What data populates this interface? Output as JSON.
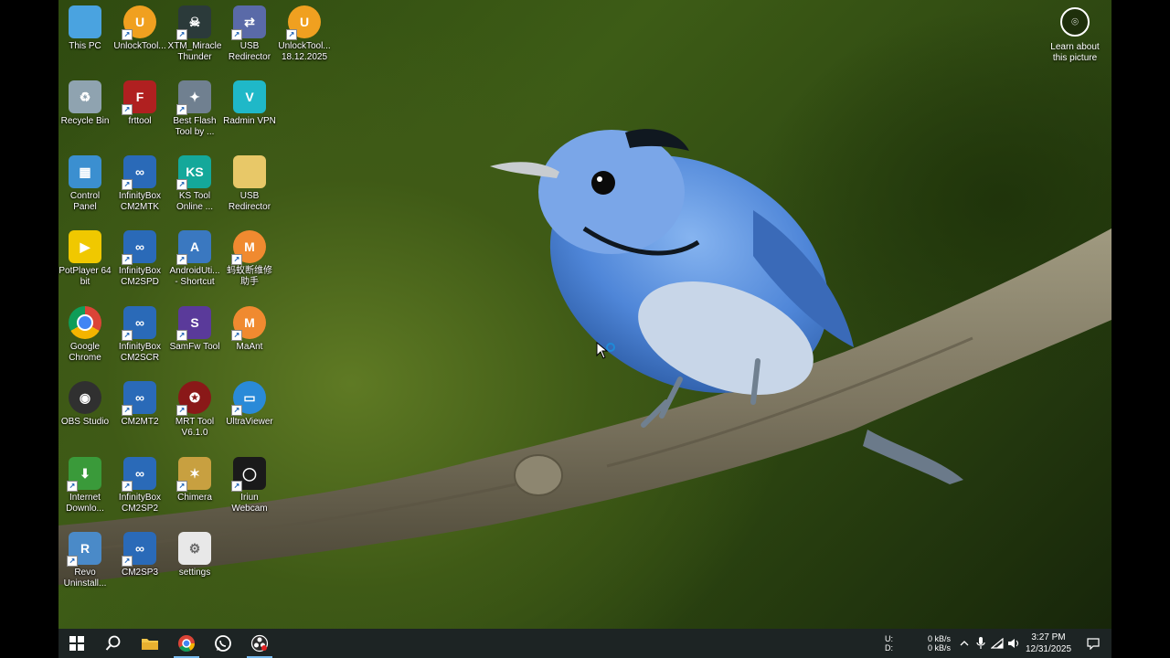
{
  "desktop_icons": [
    {
      "name": "icon-this-pc",
      "label": "This PC",
      "glyph": "computer-icon",
      "color": "#4aa3e0",
      "text": "",
      "shortcut": false
    },
    {
      "name": "icon-unlocktool-1",
      "label": "UnlockTool...",
      "glyph": "unlocktool-icon",
      "color": "#f0a020",
      "text": "U",
      "shortcut": true
    },
    {
      "name": "icon-xtm-miracle",
      "label": "XTM_Miracle\nThunder",
      "glyph": "skull-icon",
      "color": "#2b3a3a",
      "text": "☠",
      "shortcut": true
    },
    {
      "name": "icon-usb-redirector-1",
      "label": "USB\nRedirector",
      "glyph": "network-icon",
      "color": "#5a6aa8",
      "text": "⇄",
      "shortcut": true
    },
    {
      "name": "icon-unlocktool-2",
      "label": "UnlockTool...\n18.12.2025",
      "glyph": "unlocktool-icon",
      "color": "#f0a020",
      "text": "U",
      "shortcut": true
    },
    {
      "name": "icon-recycle-bin",
      "label": "Recycle Bin",
      "glyph": "recycle-bin-icon",
      "color": "#8fa3b0",
      "text": "♻",
      "shortcut": false
    },
    {
      "name": "icon-frttool",
      "label": "frttool",
      "glyph": "frttool-icon",
      "color": "#b02020",
      "text": "F",
      "shortcut": true
    },
    {
      "name": "icon-best-flash-tool",
      "label": "Best Flash\nTool by ...",
      "glyph": "tools-icon",
      "color": "#708090",
      "text": "✦",
      "shortcut": true
    },
    {
      "name": "icon-radmin-vpn",
      "label": "Radmin VPN",
      "glyph": "radmin-vpn-icon",
      "color": "#1fb8c8",
      "text": "V",
      "shortcut": false
    },
    {
      "name": "icon-control-panel",
      "label": "Control\nPanel",
      "glyph": "control-panel-icon",
      "color": "#3b8fd0",
      "text": "▦",
      "shortcut": false
    },
    {
      "name": "icon-infinitybox-cm2mtk",
      "label": "InfinityBox\nCM2MTK",
      "glyph": "infinity-icon",
      "color": "#2a6ab8",
      "text": "∞",
      "shortcut": true
    },
    {
      "name": "icon-ks-tool",
      "label": "KS Tool\nOnline ...",
      "glyph": "ks-tool-icon",
      "color": "#14a89a",
      "text": "KS",
      "shortcut": true
    },
    {
      "name": "icon-usb-redirector-2",
      "label": "USB\nRedirector",
      "glyph": "folder-icon",
      "color": "#e8c868",
      "text": "",
      "shortcut": false
    },
    {
      "name": "icon-potplayer",
      "label": "PotPlayer 64\nbit",
      "glyph": "potplayer-icon",
      "color": "#f0c800",
      "text": "▶",
      "shortcut": false
    },
    {
      "name": "icon-infinitybox-cm2spd",
      "label": "InfinityBox\nCM2SPD",
      "glyph": "infinity-icon",
      "color": "#2a6ab8",
      "text": "∞",
      "shortcut": true
    },
    {
      "name": "icon-androidutil",
      "label": "AndroidUti...\n- Shortcut",
      "glyph": "android-icon",
      "color": "#3a78c0",
      "text": "A",
      "shortcut": true
    },
    {
      "name": "icon-mayi-helper",
      "label": "蚂蚁断维修\n助手",
      "glyph": "maant-icon",
      "color": "#f08a30",
      "text": "M",
      "shortcut": true
    },
    {
      "name": "icon-google-chrome",
      "label": "Google\nChrome",
      "glyph": "chrome-icon",
      "color": "#db4437",
      "text": "",
      "shortcut": false
    },
    {
      "name": "icon-infinitybox-cm2scr",
      "label": "InfinityBox\nCM2SCR",
      "glyph": "infinity-icon",
      "color": "#2a6ab8",
      "text": "∞",
      "shortcut": true
    },
    {
      "name": "icon-samfw-tool",
      "label": "SamFw Tool",
      "glyph": "samfw-icon",
      "color": "#5a3a9a",
      "text": "S",
      "shortcut": true
    },
    {
      "name": "icon-maant",
      "label": "MaAnt",
      "glyph": "maant-icon",
      "color": "#f08a30",
      "text": "M",
      "shortcut": true
    },
    {
      "name": "icon-obs-studio",
      "label": "OBS Studio",
      "glyph": "obs-icon",
      "color": "#303030",
      "text": "◉",
      "shortcut": false
    },
    {
      "name": "icon-cm2mt2",
      "label": "CM2MT2",
      "glyph": "infinity-icon",
      "color": "#2a6ab8",
      "text": "∞",
      "shortcut": true
    },
    {
      "name": "icon-mrt-tool",
      "label": "MRT Tool\nV6.1.0",
      "glyph": "mrt-icon",
      "color": "#8a1818",
      "text": "✪",
      "shortcut": true
    },
    {
      "name": "icon-ultraviewer",
      "label": "UltraViewer",
      "glyph": "ultraviewer-icon",
      "color": "#2a8ad8",
      "text": "▭",
      "shortcut": true
    },
    {
      "name": "icon-internet-download",
      "label": "Internet\nDownlo...",
      "glyph": "idm-icon",
      "color": "#3a9a3a",
      "text": "⬇",
      "shortcut": true
    },
    {
      "name": "icon-infinitybox-cm2sp2",
      "label": "InfinityBox\nCM2SP2",
      "glyph": "infinity-icon",
      "color": "#2a6ab8",
      "text": "∞",
      "shortcut": true
    },
    {
      "name": "icon-chimera",
      "label": "Chimera",
      "glyph": "chimera-icon",
      "color": "#c8a040",
      "text": "✶",
      "shortcut": true
    },
    {
      "name": "icon-iriun-webcam",
      "label": "Iriun\nWebcam",
      "glyph": "webcam-icon",
      "color": "#1a1a1a",
      "text": "◯",
      "shortcut": true
    },
    {
      "name": "icon-revo-uninstaller",
      "label": "Revo\nUninstall...",
      "glyph": "revo-icon",
      "color": "#4a8ac8",
      "text": "R",
      "shortcut": true
    },
    {
      "name": "icon-cm2sp3",
      "label": "CM2SP3",
      "glyph": "infinity-icon",
      "color": "#2a6ab8",
      "text": "∞",
      "shortcut": true
    },
    {
      "name": "icon-settings",
      "label": "settings",
      "glyph": "settings-file-icon",
      "color": "#e8e8e8",
      "text": "⚙",
      "shortcut": false
    }
  ],
  "learn_about": {
    "label": "Learn about\nthis picture",
    "glyph": "camera-icon"
  },
  "taskbar": {
    "apps": [
      {
        "name": "start-button",
        "glyph": "windows-icon"
      },
      {
        "name": "search-button",
        "glyph": "search-icon"
      },
      {
        "name": "taskbar-file-explorer",
        "glyph": "folder-icon"
      },
      {
        "name": "taskbar-chrome",
        "glyph": "chrome-icon"
      },
      {
        "name": "taskbar-whatsapp",
        "glyph": "whatsapp-icon"
      },
      {
        "name": "taskbar-obs",
        "glyph": "obs-icon"
      }
    ],
    "network": {
      "up_label": "U:",
      "down_label": "D:",
      "up_value": "0 kB/s",
      "down_value": "0 kB/s"
    },
    "clock": {
      "time": "3:27 PM",
      "date": "12/31/2025"
    }
  },
  "colors": {
    "taskbar_bg": "#1d2424",
    "accent": "#76b9ed",
    "bird_blue": "#4f86d8"
  }
}
